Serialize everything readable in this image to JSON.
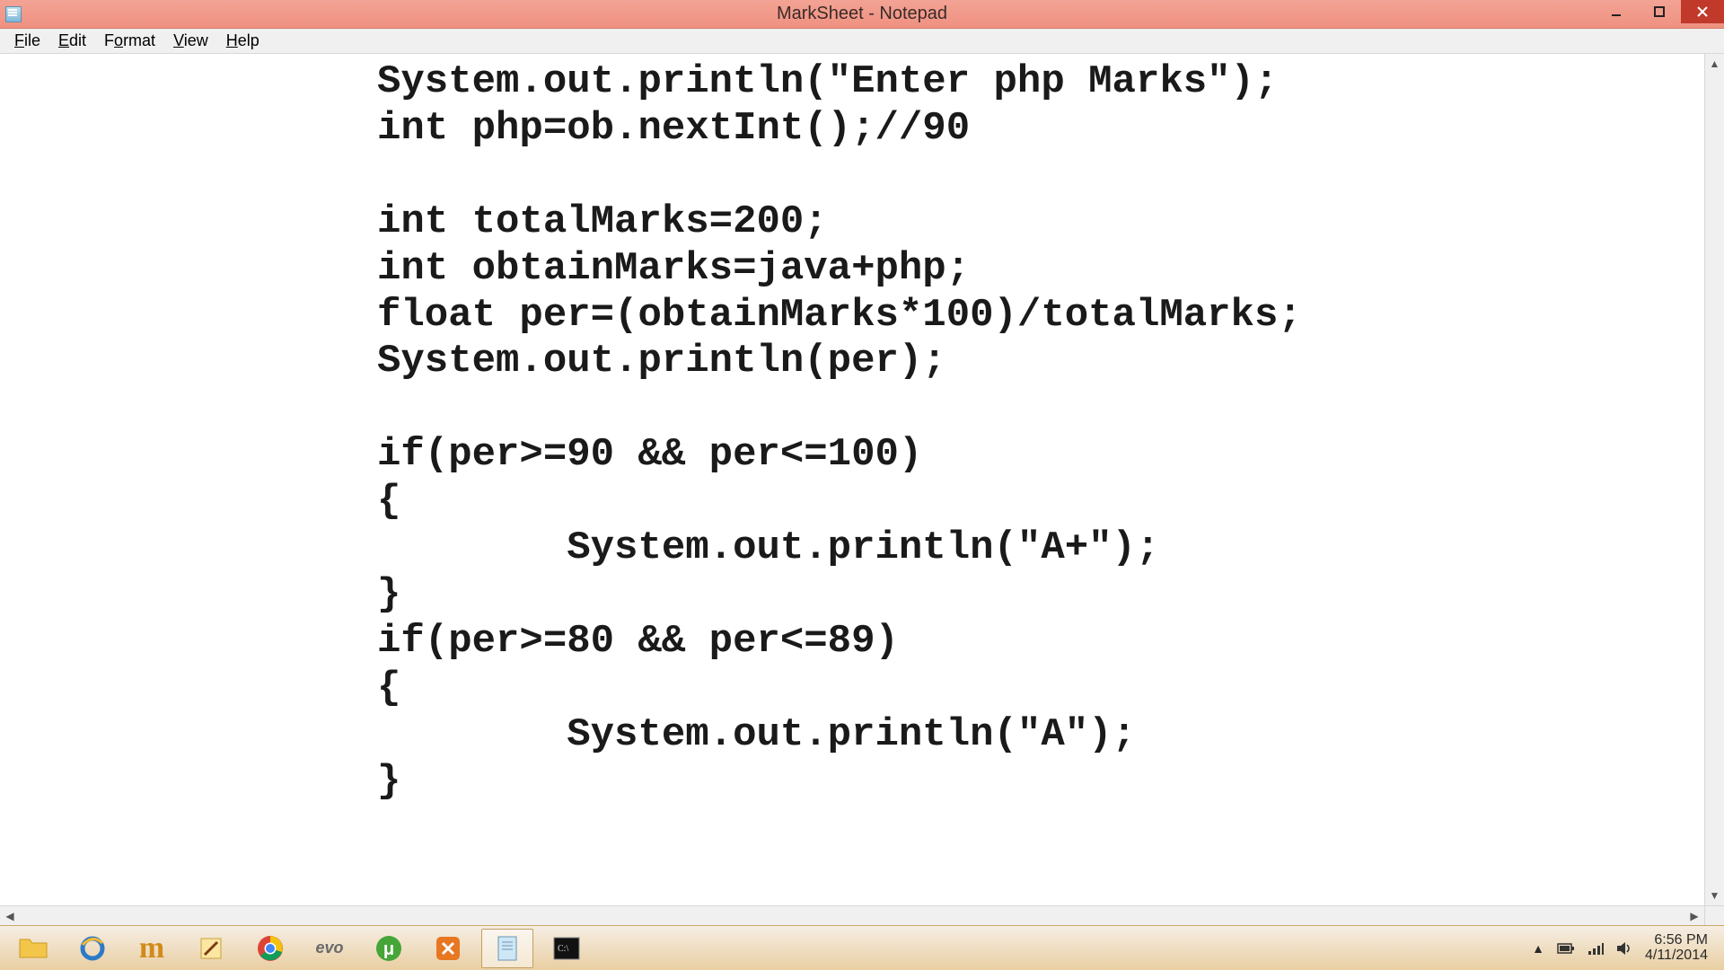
{
  "window": {
    "title": "MarkSheet - Notepad"
  },
  "menus": {
    "file": "File",
    "edit": "Edit",
    "format": "Format",
    "view": "View",
    "help": "Help"
  },
  "editor": {
    "content": "System.out.println(\"Enter php Marks\");\nint php=ob.nextInt();//90\n\nint totalMarks=200;\nint obtainMarks=java+php;\nfloat per=(obtainMarks*100)/totalMarks;\nSystem.out.println(per);\n\nif(per>=90 && per<=100)\n{\n        System.out.println(\"A+\");\n}\nif(per>=80 && per<=89)\n{\n        System.out.println(\"A\");\n}"
  },
  "taskbar": {
    "items": [
      {
        "name": "file-explorer-icon",
        "glyph": "📁"
      },
      {
        "name": "internet-explorer-icon",
        "glyph": "e"
      },
      {
        "name": "maxthon-icon",
        "glyph": "m"
      },
      {
        "name": "notepad-plus-icon",
        "glyph": "✎"
      },
      {
        "name": "chrome-icon",
        "glyph": "◉"
      },
      {
        "name": "evo-icon",
        "glyph": "evo"
      },
      {
        "name": "utorrent-icon",
        "glyph": "μ"
      },
      {
        "name": "xampp-icon",
        "glyph": "⊠"
      },
      {
        "name": "notepad-icon",
        "glyph": "📄"
      },
      {
        "name": "cmd-icon",
        "glyph": "▣"
      }
    ]
  },
  "tray": {
    "time": "6:56 PM",
    "date": "4/11/2014"
  }
}
